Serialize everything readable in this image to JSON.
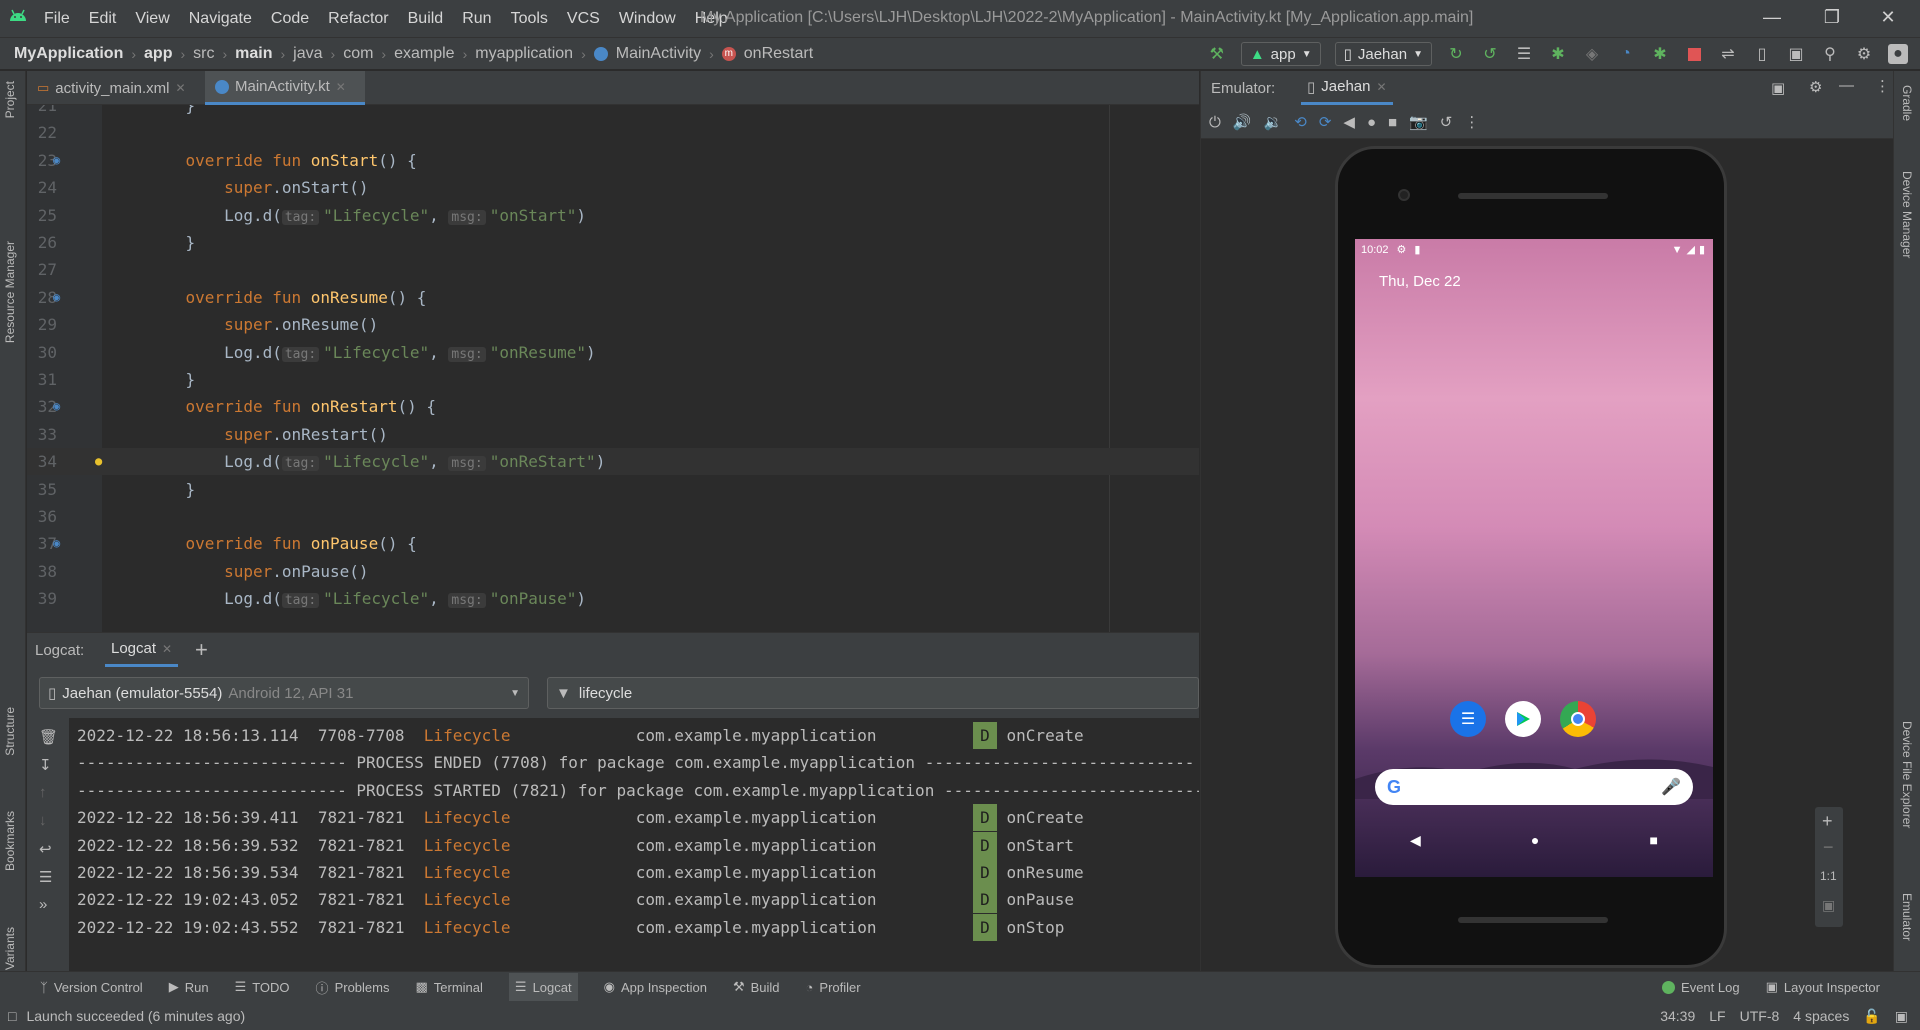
{
  "window": {
    "title": "My Application [C:\\Users\\LJH\\Desktop\\LJH\\2022-2\\MyApplication] - MainActivity.kt [My_Application.app.main]"
  },
  "menu": [
    "File",
    "Edit",
    "View",
    "Navigate",
    "Code",
    "Refactor",
    "Build",
    "Run",
    "Tools",
    "VCS",
    "Window",
    "Help"
  ],
  "breadcrumb": {
    "project": "MyApplication",
    "module": "app",
    "src": "src",
    "main": "main",
    "java": "java",
    "com": "com",
    "example": "example",
    "pkg": "myapplication",
    "cls": "MainActivity",
    "method": "onRestart"
  },
  "toolbar": {
    "run_config": "app",
    "device": "Jaehan"
  },
  "editor": {
    "tabs": [
      "activity_main.xml",
      "MainActivity.kt"
    ],
    "active_tab": "MainActivity.kt",
    "lines": [
      {
        "n": "21",
        "code": "    }"
      },
      {
        "n": "22",
        "code": ""
      },
      {
        "n": "23",
        "kw": "override fun ",
        "fn": "onStart",
        "rest": "() {"
      },
      {
        "n": "24",
        "sup": "super",
        "call": ".onStart()"
      },
      {
        "n": "25",
        "log": "Log.d(",
        "tag_hint": "tag:",
        "tag": "\"Lifecycle\"",
        "msg_hint": "msg:",
        "msg": "\"onStart\"",
        "end": ")"
      },
      {
        "n": "26",
        "code": "    }"
      },
      {
        "n": "27",
        "code": ""
      },
      {
        "n": "28",
        "kw": "override fun ",
        "fn": "onResume",
        "rest": "() {"
      },
      {
        "n": "29",
        "sup": "super",
        "call": ".onResume()"
      },
      {
        "n": "30",
        "log": "Log.d(",
        "tag_hint": "tag:",
        "tag": "\"Lifecycle\"",
        "msg_hint": "msg:",
        "msg": "\"onResume\"",
        "end": ")"
      },
      {
        "n": "31",
        "code": "    }"
      },
      {
        "n": "32",
        "kw": "override fun ",
        "fn": "onRestart",
        "rest": "() {"
      },
      {
        "n": "33",
        "sup": "super",
        "call": ".onRestart()"
      },
      {
        "n": "34",
        "log": "Log.d(",
        "tag_hint": "tag:",
        "tag": "\"Lifecycle\"",
        "msg_hint": "msg:",
        "msg": "\"onReStart\"",
        "end": ")"
      },
      {
        "n": "35",
        "code": "    }"
      },
      {
        "n": "36",
        "code": ""
      },
      {
        "n": "37",
        "kw": "override fun ",
        "fn": "onPause",
        "rest": "() {"
      },
      {
        "n": "38",
        "sup": "super",
        "call": ".onPause()"
      },
      {
        "n": "39",
        "log": "Log.d(",
        "tag_hint": "tag:",
        "tag": "\"Lifecycle\"",
        "msg_hint": "msg:",
        "msg": "\"onPause\"",
        "end": ")"
      }
    ]
  },
  "logcat": {
    "label": "Logcat:",
    "tab": "Logcat",
    "device": "Jaehan (emulator-5554)",
    "device_info": "Android 12, API 31",
    "filter": "lifecycle",
    "rows": [
      {
        "ts": "2022-12-22 18:56:13.114",
        "pid": "7708-7708",
        "tag": "Lifecycle",
        "pkg": "com.example.myapplication",
        "lvl": "D",
        "msg": "onCreate"
      },
      {
        "sep": "---------------------------- PROCESS ENDED (7708) for package com.example.myapplication ----------------------------"
      },
      {
        "sep": "---------------------------- PROCESS STARTED (7821) for package com.example.myapplication ----------------------------"
      },
      {
        "ts": "2022-12-22 18:56:39.411",
        "pid": "7821-7821",
        "tag": "Lifecycle",
        "pkg": "com.example.myapplication",
        "lvl": "D",
        "msg": "onCreate"
      },
      {
        "ts": "2022-12-22 18:56:39.532",
        "pid": "7821-7821",
        "tag": "Lifecycle",
        "pkg": "com.example.myapplication",
        "lvl": "D",
        "msg": "onStart"
      },
      {
        "ts": "2022-12-22 18:56:39.534",
        "pid": "7821-7821",
        "tag": "Lifecycle",
        "pkg": "com.example.myapplication",
        "lvl": "D",
        "msg": "onResume"
      },
      {
        "ts": "2022-12-22 19:02:43.052",
        "pid": "7821-7821",
        "tag": "Lifecycle",
        "pkg": "com.example.myapplication",
        "lvl": "D",
        "msg": "onPause"
      },
      {
        "ts": "2022-12-22 19:02:43.552",
        "pid": "7821-7821",
        "tag": "Lifecycle",
        "pkg": "com.example.myapplication",
        "lvl": "D",
        "msg": "onStop"
      }
    ]
  },
  "emulator": {
    "label": "Emulator:",
    "tab": "Jaehan",
    "time": "10:02",
    "date": "Thu, Dec 22",
    "zoom": "1:1"
  },
  "left_tools": [
    "Project",
    "Resource Manager",
    "Structure",
    "Bookmarks",
    "Build Variants"
  ],
  "right_tools": [
    "Gradle",
    "Device Manager",
    "Device File Explorer",
    "Emulator"
  ],
  "bottom_tools": [
    "Version Control",
    "Run",
    "TODO",
    "Problems",
    "Terminal",
    "Logcat",
    "App Inspection",
    "Build",
    "Profiler"
  ],
  "bottom_right_tools": [
    "Event Log",
    "Layout Inspector"
  ],
  "status": {
    "message": "Launch succeeded (6 minutes ago)",
    "position": "34:39",
    "line_sep": "LF",
    "encoding": "UTF-8",
    "indent": "4 spaces"
  }
}
